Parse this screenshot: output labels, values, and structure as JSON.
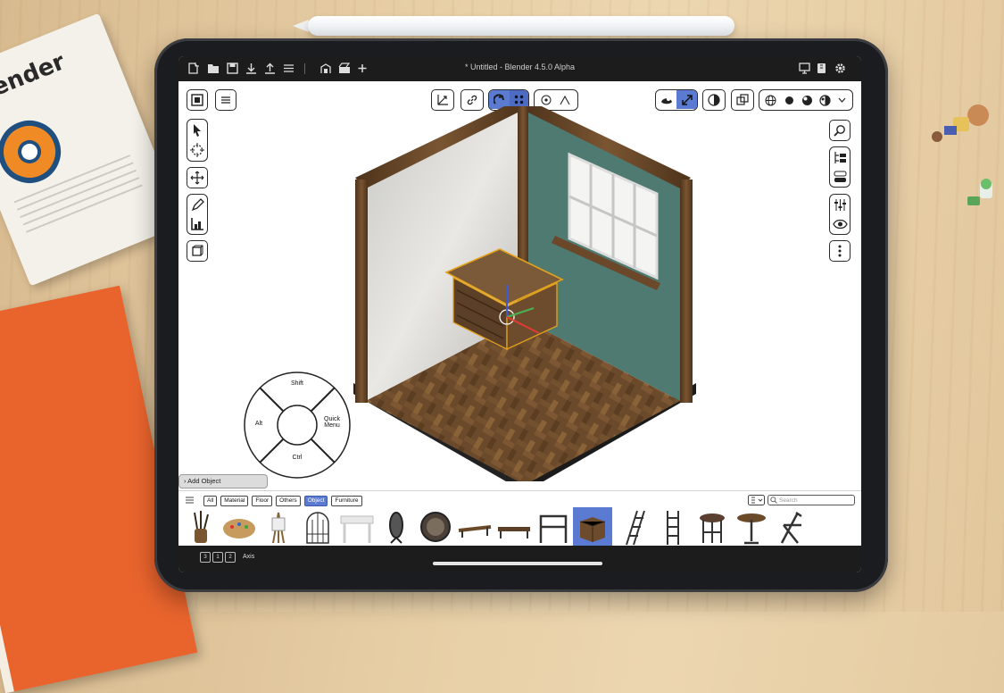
{
  "window": {
    "title": "* Untitled - Blender 4.5.0 Alpha"
  },
  "business_card": {
    "logo_text": "blender"
  },
  "topbar": {
    "left_icons": [
      "new-file-icon",
      "folder-icon",
      "save-icon",
      "import-icon",
      "export-icon",
      "menu-icon",
      "scene-icon",
      "render-icon",
      "add-icon"
    ],
    "right_icons": [
      "display-icon",
      "bookmark-icon",
      "settings-icon"
    ]
  },
  "viewport": {
    "header_center": [
      "transform-gizmo-icon",
      "link-icon",
      "tool-active-icon",
      "snap-grid-icon",
      "pivot-icon",
      "proportional-icon"
    ],
    "header_right": [
      "overlay-icon",
      "gizmo-icon",
      "shading-solid-icon",
      "xray-icon",
      "shading-wire-icon",
      "shading-solid-dot-icon",
      "shading-material-icon",
      "shading-rendered-icon",
      "dropdown-icon"
    ]
  },
  "pie_menu": {
    "top": "Shift",
    "left": "Alt",
    "right_line1": "Quick",
    "right_line2": "Menu",
    "bottom": "Ctrl"
  },
  "asset_panel": {
    "add_object_label": "Add Object",
    "filters": [
      {
        "label": "All",
        "active": false
      },
      {
        "label": "Material",
        "active": false
      },
      {
        "label": "Floor",
        "active": false
      },
      {
        "label": "Others",
        "active": false
      },
      {
        "label": "Object",
        "active": true
      },
      {
        "label": "Furniture",
        "active": false
      }
    ],
    "search_placeholder": "Search",
    "items": [
      "paintbrushes",
      "palette",
      "easel",
      "birdcage",
      "desk",
      "mirror",
      "clock",
      "bench",
      "coffee-table",
      "chair-frame",
      "dresser",
      "ladder",
      "stepladder",
      "stool",
      "round-table",
      "folding-chair"
    ],
    "selected_item": "dresser"
  },
  "statusbar": {
    "keys": [
      "3",
      "1",
      "2"
    ],
    "text": "Axis"
  },
  "colors": {
    "accent": "#5b7bd2",
    "wall_green": "#4f7a72",
    "wood": "#6b4a2a",
    "selection": "#e4a21c"
  }
}
